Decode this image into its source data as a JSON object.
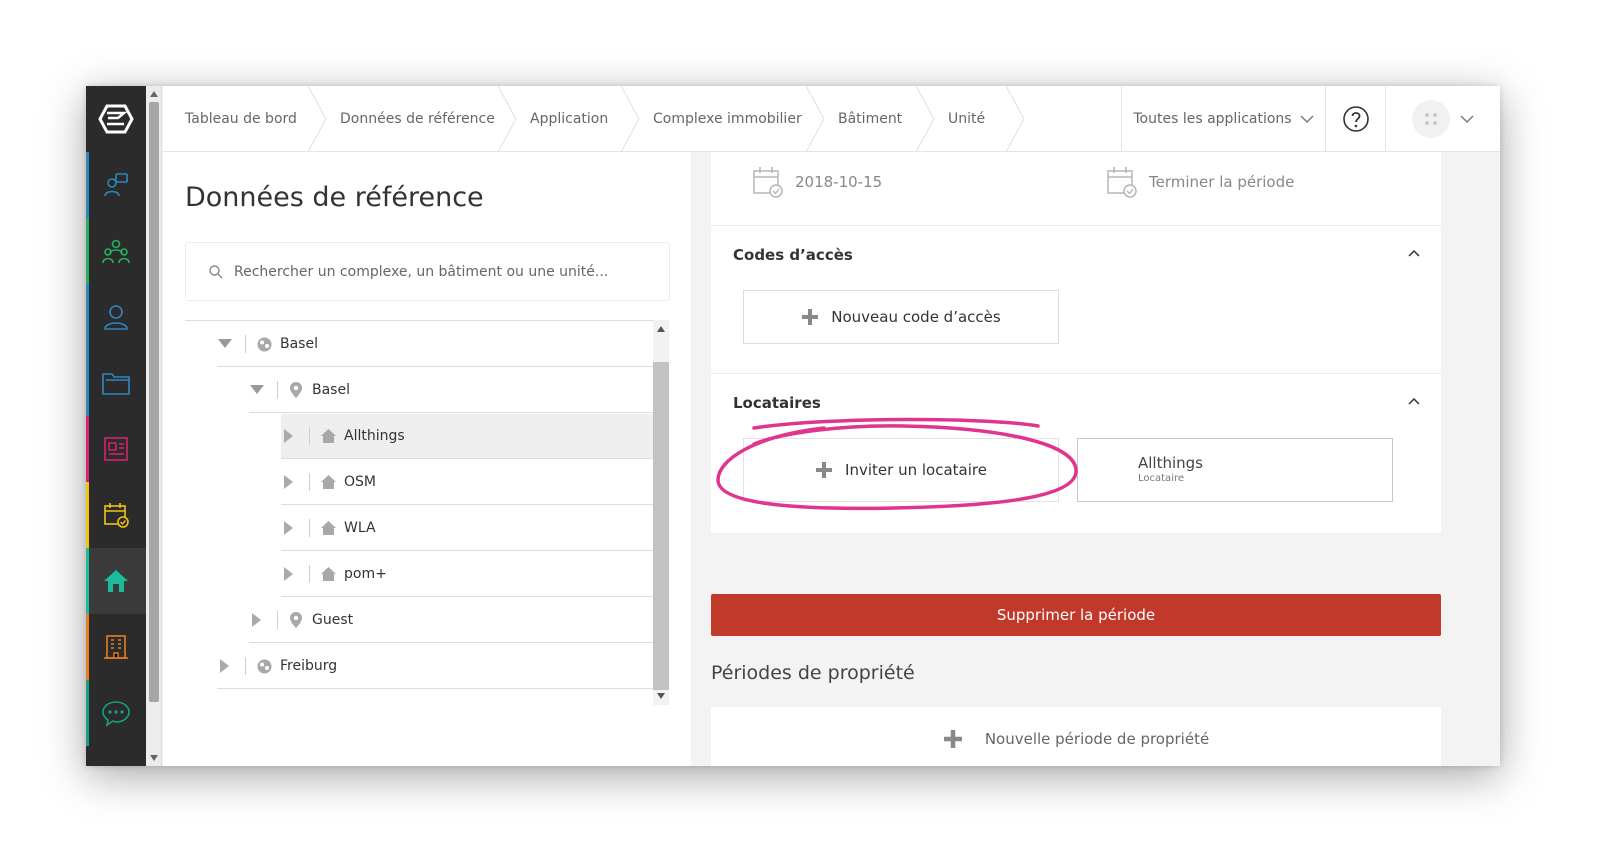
{
  "nav": {
    "items": [
      {
        "name": "chat-users-icon",
        "color": "#2e86c1"
      },
      {
        "name": "community-icon",
        "color": "#27ae60"
      },
      {
        "name": "user-icon",
        "color": "#2e86c1"
      },
      {
        "name": "folder-icon",
        "color": "#2e86c1"
      },
      {
        "name": "news-icon",
        "color": "#d6246e"
      },
      {
        "name": "calendar-check-icon",
        "color": "#f1c40f"
      },
      {
        "name": "home-icon",
        "color": "#1abc9c",
        "active": true
      },
      {
        "name": "building-icon",
        "color": "#e67e22"
      },
      {
        "name": "message-icon",
        "color": "#16a085"
      }
    ]
  },
  "header": {
    "breadcrumbs": [
      "Tableau de bord",
      "Données de référence",
      "Application",
      "Complexe immobilier",
      "Bâtiment",
      "Unité"
    ],
    "apps_switch": "Toutes les applications"
  },
  "left": {
    "title": "Données de référence",
    "search_placeholder": "Rechercher un complexe, un bâtiment ou une unité...",
    "tree": [
      {
        "label": "Basel",
        "type": "globe",
        "level": 0,
        "expanded": true
      },
      {
        "label": "Basel",
        "type": "pin",
        "level": 1,
        "expanded": true
      },
      {
        "label": "Allthings",
        "type": "house",
        "level": 2,
        "expanded": false,
        "selected": true
      },
      {
        "label": "OSM",
        "type": "house",
        "level": 2,
        "expanded": false
      },
      {
        "label": "WLA",
        "type": "house",
        "level": 2,
        "expanded": false
      },
      {
        "label": "pom+",
        "type": "house",
        "level": 2,
        "expanded": false
      },
      {
        "label": "Guest",
        "type": "pin",
        "level": 1,
        "expanded": false
      },
      {
        "label": "Freiburg",
        "type": "globe",
        "level": 0,
        "expanded": false
      }
    ]
  },
  "right": {
    "start_date": "2018-10-15",
    "end_period": "Terminer la période",
    "access_codes": {
      "title": "Codes d’accès",
      "new_code": "Nouveau code d’accès"
    },
    "tenants": {
      "title": "Locataires",
      "invite": "Inviter un locataire",
      "tenant_name": "Allthings",
      "tenant_role": "Locataire"
    },
    "delete_period": "Supprimer la période",
    "ownership": {
      "title": "Périodes de propriété",
      "new": "Nouvelle période de propriété"
    }
  },
  "colors": {
    "danger": "#c0392b",
    "annotation": "#e0358e",
    "nav_bg": "#2b2b2b"
  }
}
